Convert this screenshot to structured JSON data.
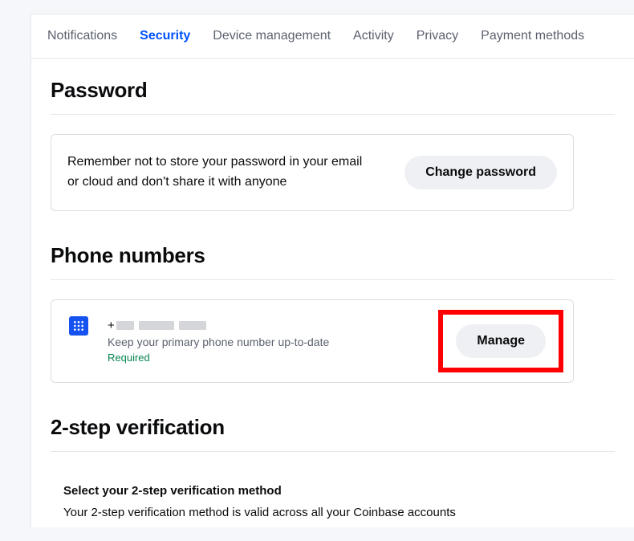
{
  "tabs": [
    {
      "label": "Notifications",
      "active": false
    },
    {
      "label": "Security",
      "active": true
    },
    {
      "label": "Device management",
      "active": false
    },
    {
      "label": "Activity",
      "active": false
    },
    {
      "label": "Privacy",
      "active": false
    },
    {
      "label": "Payment methods",
      "active": false
    }
  ],
  "password": {
    "title": "Password",
    "description": "Remember not to store your password in your email or cloud and don't share it with anyone",
    "button": "Change password"
  },
  "phone": {
    "title": "Phone numbers",
    "numberPrefix": "+",
    "subtext": "Keep your primary phone number up-to-date",
    "required": "Required",
    "button": "Manage"
  },
  "twostep": {
    "title": "2-step verification",
    "subtitle": "Select your 2-step verification method",
    "description": "Your 2-step verification method is valid across all your Coinbase accounts"
  }
}
